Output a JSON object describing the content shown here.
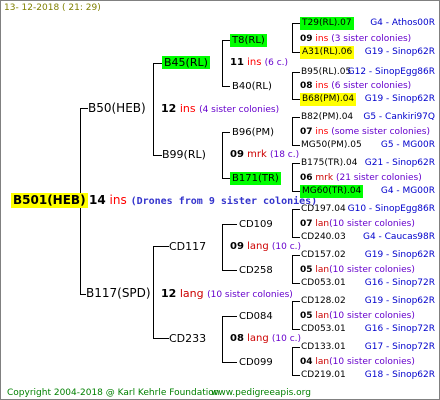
{
  "header": {
    "date": "13- 12-2018 ( 21: 29)"
  },
  "footer": {
    "copyright": "Copyright 2004-2018 @ Karl Kehrle Foundation",
    "website": "www.pedigreeapis.org"
  },
  "root": {
    "code": "B501(HEB)",
    "num": "14",
    "suffix": "ins",
    "note": "(Drones from 9 sister colonies)"
  },
  "mother": {
    "code": "B50(HEB)",
    "num": "12",
    "suffix": "ins",
    "note": "(4 sister colonies)"
  },
  "father": {
    "code": "B117(SPD)",
    "num": "12",
    "suffix": "lang",
    "note": "(10 sister colonies)"
  },
  "g3": {
    "b45": {
      "code": "B45(RL)",
      "num": "11",
      "suffix": "ins",
      "note": "(6 c.)"
    },
    "b99": {
      "code": "B99(RL)",
      "num": "09",
      "suffix": "mrk",
      "note": "(18 c.)"
    },
    "cd117": {
      "code": "CD117",
      "num": "09",
      "suffix": "lang",
      "note": "(10 c.)"
    },
    "cd233": {
      "code": "CD233",
      "num": "08",
      "suffix": "lang",
      "note": "(10 c.)"
    }
  },
  "g4": {
    "t8": {
      "code": "T8(RL)"
    },
    "b40": {
      "code": "B40(RL)"
    },
    "b96": {
      "code": "B96(PM)"
    },
    "b171": {
      "code": "B171(TR)"
    },
    "cd109": {
      "code": "CD109"
    },
    "cd258": {
      "code": "CD258"
    },
    "cd084": {
      "code": "CD084"
    },
    "cd099": {
      "code": "CD099"
    }
  },
  "g5": [
    {
      "num": "09",
      "suffix": "ins",
      "note": "(3 sister colonies)"
    },
    {
      "num": "08",
      "suffix": "ins",
      "note": "(6 sister colonies)"
    },
    {
      "num": "07",
      "suffix": "ins",
      "note": "(some sister colonies)"
    },
    {
      "num": "06",
      "suffix": "mrk",
      "note": "(21 sister colonies)"
    },
    {
      "num": "07",
      "suffix": "lan",
      "note": "(10 sister colonies)"
    },
    {
      "num": "05",
      "suffix": "lan",
      "note": "(10 sister colonies)"
    },
    {
      "num": "05",
      "suffix": "lan",
      "note": "(10 sister colonies)"
    },
    {
      "num": "04",
      "suffix": "lan",
      "note": "(10 sister colonies)"
    }
  ],
  "g6": [
    {
      "code": "T29(RL).07",
      "source": "G4 - Athos00R"
    },
    {
      "code": "A31(RL).06",
      "source": "G19 - Sinop62R"
    },
    {
      "code": "B95(RL).05",
      "source": "G12 - SinopEgg86R"
    },
    {
      "code": "B68(PM).04",
      "source": "G19 - Sinop62R"
    },
    {
      "code": "B82(PM).04",
      "source": "G5 - Cankiri97Q"
    },
    {
      "code": "MG50(PM).05",
      "source": "G5 - MG00R"
    },
    {
      "code": "B175(TR).04",
      "source": "G21 - Sinop62R"
    },
    {
      "code": "MG60(TR).04",
      "source": "G4 - MG00R"
    },
    {
      "code": "CD197.04",
      "source": "G10 - SinopEgg86R"
    },
    {
      "code": "CD240.03",
      "source": "G4 - Caucas98R"
    },
    {
      "code": "CD157.02",
      "source": "G19 - Sinop62R"
    },
    {
      "code": "CD053.01",
      "source": "G16 - Sinop72R"
    },
    {
      "code": "CD128.02",
      "source": "G19 - Sinop62R"
    },
    {
      "code": "CD053.01",
      "source": "G16 - Sinop72R"
    },
    {
      "code": "CD133.01",
      "source": "G17 - Sinop72R"
    },
    {
      "code": "CD219.01",
      "source": "G18 - Sinop62R"
    }
  ]
}
